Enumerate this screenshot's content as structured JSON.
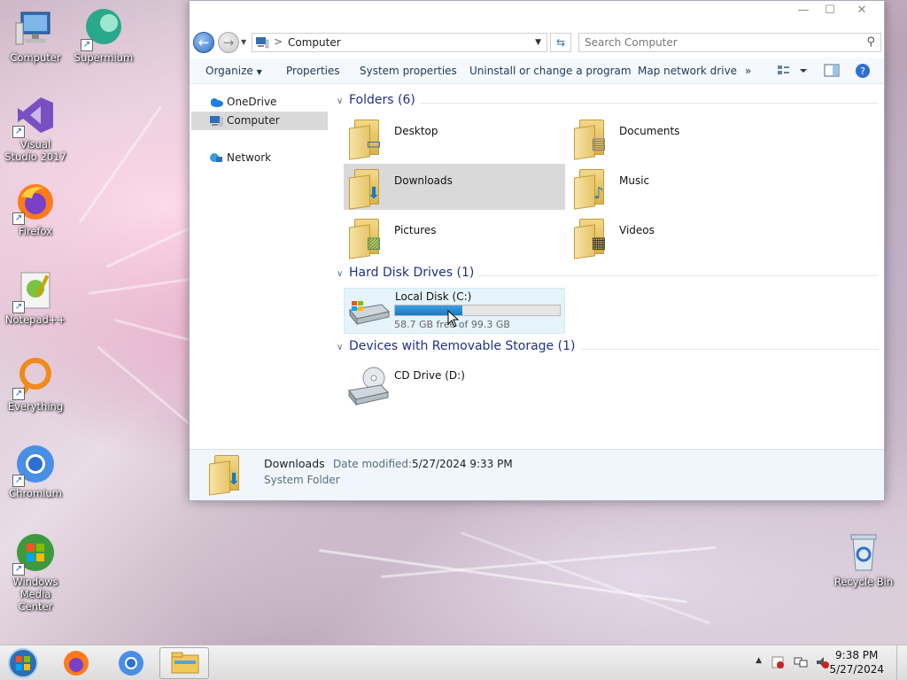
{
  "desktop": {
    "icons": [
      {
        "label": "Computer"
      },
      {
        "label": "Supermium"
      },
      {
        "label": "Visual Studio 2017"
      },
      {
        "label": "Firefox"
      },
      {
        "label": "Notepad++"
      },
      {
        "label": "Everything"
      },
      {
        "label": "Chromium"
      },
      {
        "label": "Windows Media Center"
      },
      {
        "label": "Recycle Bin"
      }
    ]
  },
  "window": {
    "address": {
      "path": "Computer",
      "separator": ">"
    },
    "search_placeholder": "Search Computer",
    "toolbar": {
      "organize": "Organize",
      "properties": "Properties",
      "system_properties": "System properties",
      "uninstall": "Uninstall or change a program",
      "map_drive": "Map network drive",
      "more": "»"
    },
    "nav": {
      "onedrive": "OneDrive",
      "computer": "Computer",
      "network": "Network"
    },
    "groups": {
      "folders": "Folders (6)",
      "hdd": "Hard Disk Drives (1)",
      "removable": "Devices with Removable Storage (1)"
    },
    "folders": [
      "Desktop",
      "Documents",
      "Downloads",
      "Music",
      "Pictures",
      "Videos"
    ],
    "disk": {
      "name": "Local Disk (C:)",
      "free_text": "58.7 GB free of 99.3 GB",
      "used_fraction": 0.41
    },
    "cd": {
      "name": "CD Drive (D:)"
    },
    "status": {
      "name": "Downloads",
      "date_label": "Date modified:",
      "date": "5/27/2024 9:33 PM",
      "type": "System Folder"
    }
  },
  "taskbar": {
    "time": "9:38 PM",
    "date": "5/27/2024"
  },
  "colors": {
    "accent": "#1a78c2",
    "group_header": "#1e3287"
  }
}
